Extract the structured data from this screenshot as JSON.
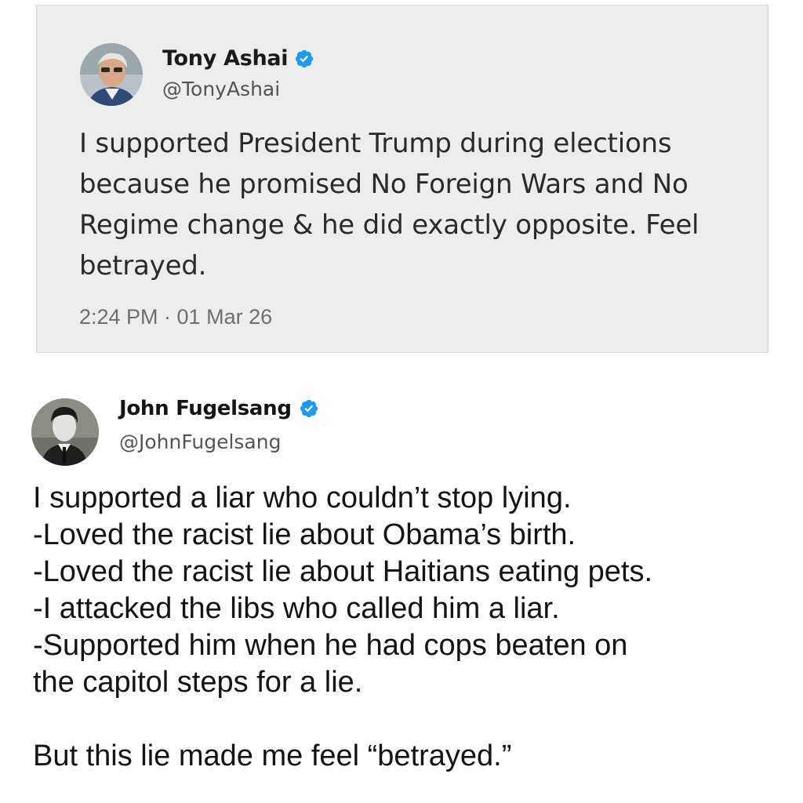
{
  "quoted_tweet": {
    "author": {
      "display_name": "Tony Ashai",
      "handle": "@TonyAshai",
      "verified": true,
      "avatar_icon": "profile-photo-icon"
    },
    "text": "I supported President Trump during elections because he promised No Foreign Wars and No Regime change & he did exactly opposite. Feel betrayed.",
    "timestamp": "2:24 PM · 01 Mar 26"
  },
  "main_tweet": {
    "author": {
      "display_name": "John Fugelsang",
      "handle": "@JohnFugelsang",
      "verified": true,
      "avatar_icon": "profile-photo-icon"
    },
    "lines": [
      "I supported a liar who couldn’t stop lying.",
      "-Loved the racist lie about Obama’s birth.",
      "-Loved the racist lie about Haitians eating pets.",
      "-I attacked the libs who called him a liar.",
      "-Supported him when he had cops beaten on",
      "the capitol steps for a lie."
    ],
    "closing_line": "But this lie made me feel “betrayed.”"
  },
  "colors": {
    "verified_badge": "#1d9bf0",
    "quoted_background": "#ededed",
    "page_background": "#ffffff"
  }
}
